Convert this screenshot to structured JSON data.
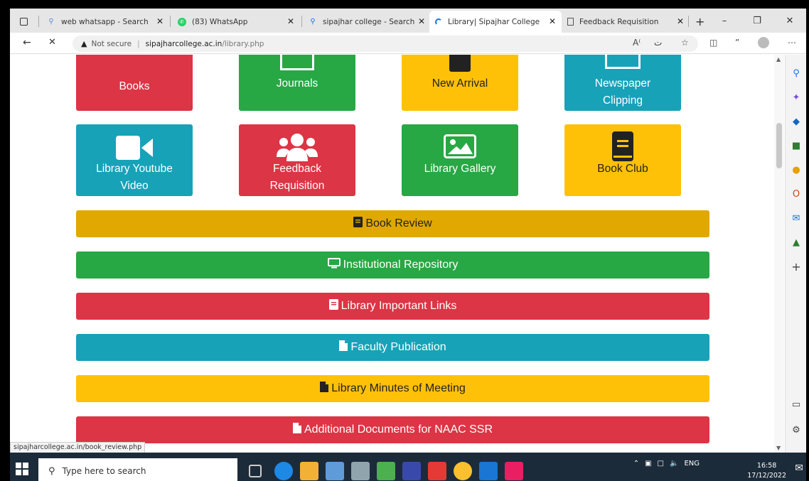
{
  "tabs": [
    {
      "title": "web whatsapp - Search",
      "icon": "search-icon"
    },
    {
      "title": "(83) WhatsApp",
      "icon": "whatsapp-icon"
    },
    {
      "title": "sipajhar college - Search",
      "icon": "search-icon"
    },
    {
      "title": "Library| Sipajhar College",
      "icon": "loading-icon"
    },
    {
      "title": "Feedback Requisition",
      "icon": "page-icon"
    }
  ],
  "address": {
    "security": "Not secure",
    "host": "sipajharcollege.ac.in",
    "path": "/library.php"
  },
  "tiles_row1": [
    {
      "label": "Books",
      "color": "#dc3545"
    },
    {
      "label": "Journals",
      "color": "#28a745"
    },
    {
      "label": "New Arrival",
      "color": "#ffc107"
    },
    {
      "label": "Newspaper Clipping",
      "color": "#17a2b8"
    }
  ],
  "tiles_row2": [
    {
      "label": "Library Youtube Video",
      "color": "#17a2b8",
      "icon": "video-camera-icon"
    },
    {
      "label": "Feedback Requisition",
      "color": "#dc3545",
      "icon": "users-icon"
    },
    {
      "label": "Library Gallery",
      "color": "#28a745",
      "icon": "image-icon"
    },
    {
      "label": "Book Club",
      "color": "#ffc107",
      "icon": "book-icon"
    }
  ],
  "bars": [
    {
      "label": "Book Review",
      "color": "#e0a800",
      "icon": "book-icon"
    },
    {
      "label": "Institutional Repository",
      "color": "#28a745",
      "icon": "desktop-icon"
    },
    {
      "label": "Library Important Links",
      "color": "#dc3545",
      "icon": "book-icon"
    },
    {
      "label": "Faculty Publication",
      "color": "#17a2b8",
      "icon": "file-icon"
    },
    {
      "label": "Library Minutes of Meeting",
      "color": "#ffc107",
      "icon": "file-icon"
    },
    {
      "label": "Additional Documents for NAAC SSR",
      "color": "#dc3545",
      "icon": "file-icon"
    }
  ],
  "status_link": "sipajharcollege.ac.in/book_review.php",
  "taskbar": {
    "search_placeholder": "Type here to search",
    "language": "ENG",
    "time": "16:58",
    "date": "17/12/2022"
  }
}
